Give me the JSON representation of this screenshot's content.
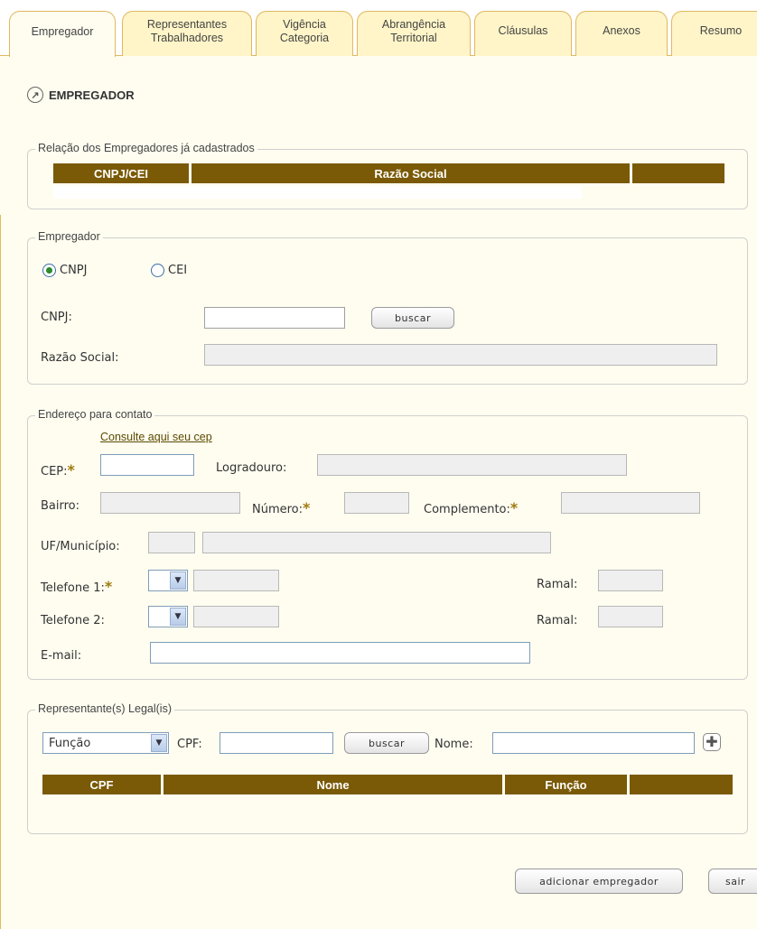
{
  "tabs": [
    {
      "label": "Empregador",
      "active": true
    },
    {
      "label": "Representantes\nTrabalhadores",
      "active": false
    },
    {
      "label": "Vigência\nCategoria",
      "active": false
    },
    {
      "label": "Abrangência\nTerritorial",
      "active": false
    },
    {
      "label": "Cláusulas",
      "active": false
    },
    {
      "label": "Anexos",
      "active": false
    },
    {
      "label": "Resumo",
      "active": false
    }
  ],
  "section_title": "EMPREGADOR",
  "registered": {
    "legend": "Relação dos Empregadores já cadastrados",
    "columns": [
      "CNPJ/CEI",
      "Razão Social",
      ""
    ]
  },
  "employer": {
    "legend": "Empregador",
    "radio_cnpj": "CNPJ",
    "radio_cei": "CEI",
    "selected": "CNPJ",
    "cnpj_label": "CNPJ:",
    "cnpj_value": "",
    "search_button": "buscar",
    "razao_label": "Razão Social:",
    "razao_value": ""
  },
  "address": {
    "legend": "Endereço para contato",
    "cep_link": "Consulte aqui seu cep",
    "cep_label": "CEP:",
    "logradouro_label": "Logradouro:",
    "bairro_label": "Bairro:",
    "numero_label": "Número:",
    "complemento_label": "Complemento:",
    "uf_label": "UF/Município:",
    "tel1_label": "Telefone 1:",
    "tel2_label": "Telefone 2:",
    "ramal_label": "Ramal:",
    "email_label": "E-mail:",
    "required_mark": "*"
  },
  "legal": {
    "legend": "Representante(s) Legal(is)",
    "funcao_selected": "Função",
    "cpf_label": "CPF:",
    "search_button": "buscar",
    "nome_label": "Nome:",
    "columns": [
      "CPF",
      "Nome",
      "Função",
      ""
    ]
  },
  "actions": {
    "add_button": "adicionar empregador",
    "exit_button": "sair"
  }
}
